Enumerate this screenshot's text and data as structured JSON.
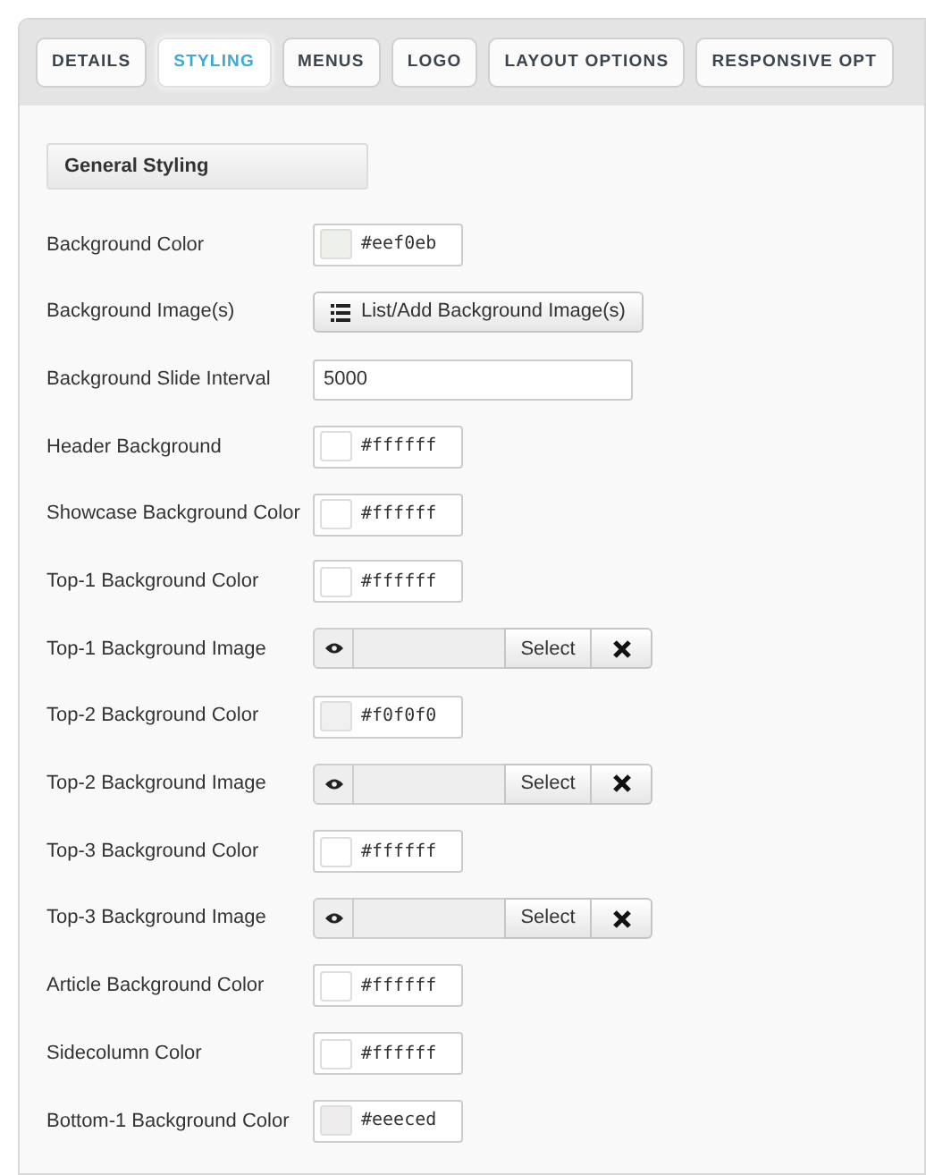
{
  "tabs": [
    {
      "label": "DETAILS",
      "selected": false
    },
    {
      "label": "STYLING",
      "selected": true
    },
    {
      "label": "MENUS",
      "selected": false
    },
    {
      "label": "LOGO",
      "selected": false
    },
    {
      "label": "LAYOUT OPTIONS",
      "selected": false
    },
    {
      "label": "RESPONSIVE OPT",
      "selected": false
    }
  ],
  "section_title": "General Styling",
  "fields": [
    {
      "kind": "color",
      "label": "Background Color",
      "value": "#eef0eb",
      "color": "#eef0eb"
    },
    {
      "kind": "button",
      "label": "Background Image(s)",
      "button": "List/Add Background Image(s)"
    },
    {
      "kind": "text",
      "label": "Background Slide Interval",
      "value": "5000"
    },
    {
      "kind": "color",
      "label": "Header Background",
      "value": "#ffffff",
      "color": "#ffffff"
    },
    {
      "kind": "color",
      "label": "Showcase Background Color",
      "value": "#ffffff",
      "color": "#ffffff"
    },
    {
      "kind": "color",
      "label": "Top-1 Background Color",
      "value": "#ffffff",
      "color": "#ffffff"
    },
    {
      "kind": "image",
      "label": "Top-1 Background Image",
      "button": "Select"
    },
    {
      "kind": "color",
      "label": "Top-2 Background Color",
      "value": "#f0f0f0",
      "color": "#f0f0f0"
    },
    {
      "kind": "image",
      "label": "Top-2 Background Image",
      "button": "Select"
    },
    {
      "kind": "color",
      "label": "Top-3 Background Color",
      "value": "#ffffff",
      "color": "#ffffff"
    },
    {
      "kind": "image",
      "label": "Top-3 Background Image",
      "button": "Select"
    },
    {
      "kind": "color",
      "label": "Article Background Color",
      "value": "#ffffff",
      "color": "#ffffff"
    },
    {
      "kind": "color",
      "label": "Sidecolumn Color",
      "value": "#ffffff",
      "color": "#ffffff"
    },
    {
      "kind": "color",
      "label": "Bottom-1 Background Color",
      "value": "#eeeced",
      "color": "#eeeced"
    }
  ]
}
